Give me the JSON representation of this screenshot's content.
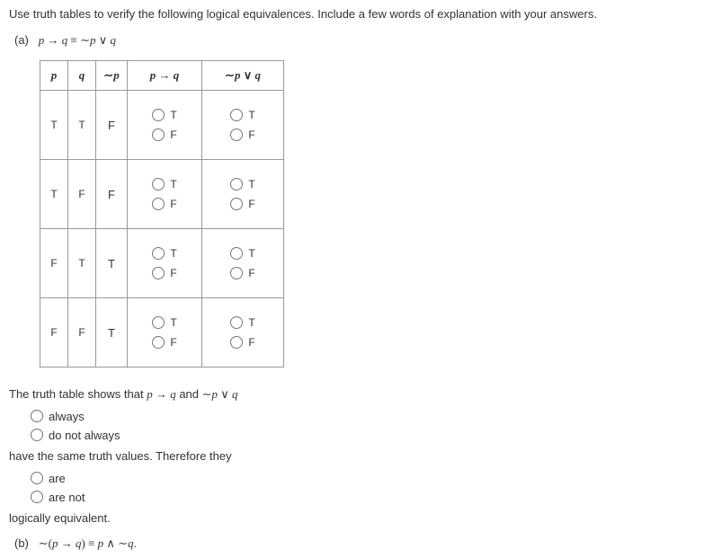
{
  "question": "Use truth tables to verify the following logical equivalences. Include a few words of explanation with your answers.",
  "partA": {
    "label": "(a)",
    "equivalence_lhs_var1": "p",
    "arrow": " → ",
    "equivalence_lhs_var2": "q",
    "equiv": " ≡ ",
    "neg": "∼",
    "or": " ∨ ",
    "var_p": "p",
    "var_q": "q"
  },
  "table": {
    "headers": {
      "p": "p",
      "q": "q",
      "notp_sym": "∼",
      "notp_var": "p",
      "impl_p": "p",
      "impl_arrow": " → ",
      "impl_q": "q",
      "disj_neg": "∼",
      "disj_p": "p",
      "disj_or": " ∨ ",
      "disj_q": "q"
    },
    "rows": [
      {
        "p": "T",
        "q": "T",
        "notp": "F"
      },
      {
        "p": "T",
        "q": "F",
        "notp": "F"
      },
      {
        "p": "F",
        "q": "T",
        "notp": "T"
      },
      {
        "p": "F",
        "q": "F",
        "notp": "T"
      }
    ],
    "options": {
      "T": "T",
      "F": "F"
    }
  },
  "conclusion": {
    "line1_prefix": "The truth table shows that ",
    "expr1_p": "p",
    "expr1_arrow": " → ",
    "expr1_q": "q",
    "and_word": " and ",
    "expr2_neg": "∼",
    "expr2_p": "p",
    "expr2_or": " ∨ ",
    "expr2_q": "q",
    "opt1a": "always",
    "opt1b": "do not always",
    "line2": "have the same truth values. Therefore they",
    "opt2a": "are",
    "opt2b": "are not",
    "line3": "logically equivalent."
  },
  "partB": {
    "label": "(b)",
    "neg": "∼",
    "lparen": "(",
    "var_p": "p",
    "arrow": " → ",
    "var_q": "q",
    "rparen": ")",
    "equiv": " ≡ ",
    "and_sym": " ∧ ",
    "neg2": "∼",
    "period": "."
  }
}
